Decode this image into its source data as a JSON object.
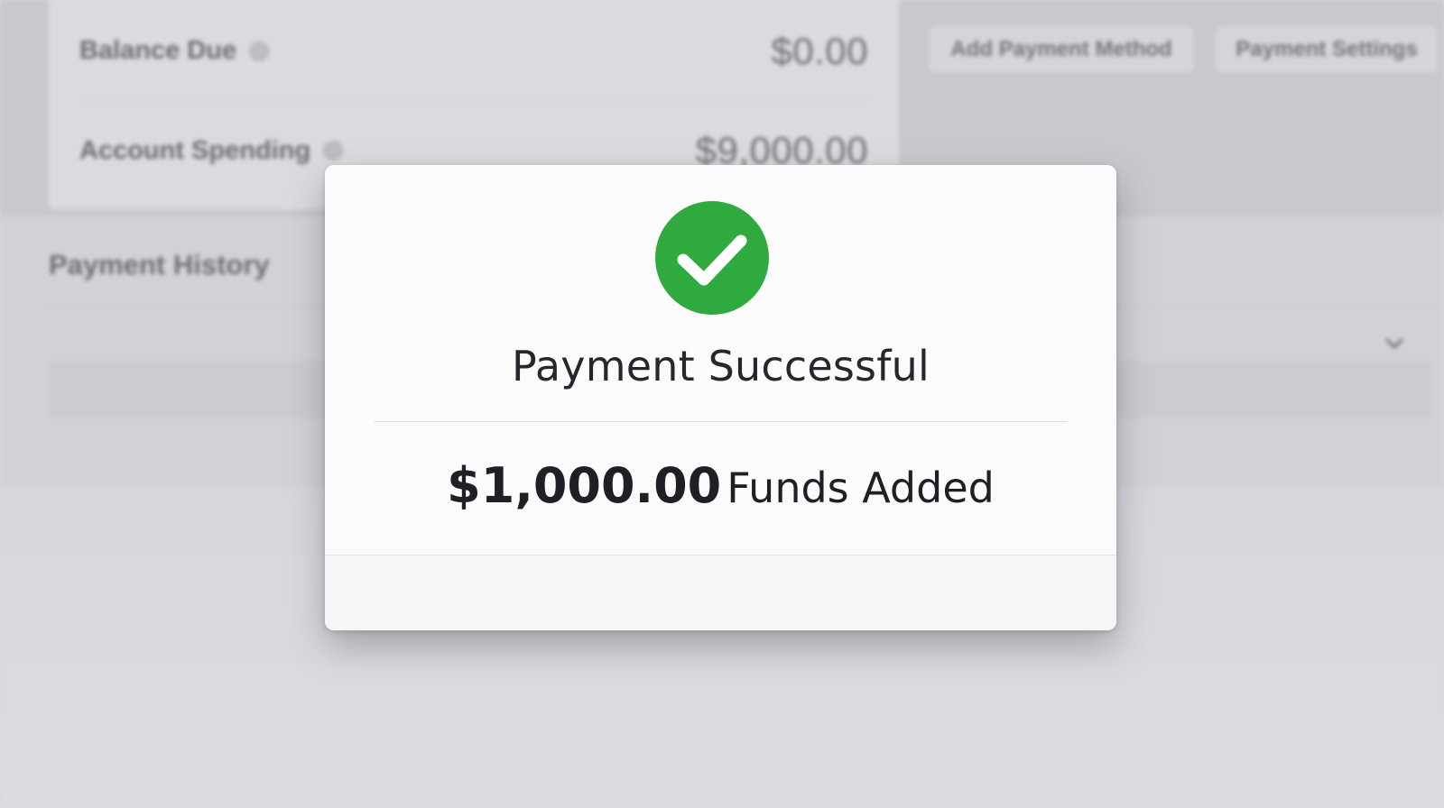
{
  "background": {
    "summary": {
      "balance_due": {
        "label": "Balance Due",
        "value": "$0.00"
      },
      "account_spending": {
        "label": "Account Spending",
        "value": "$9,000.00"
      }
    },
    "buttons": {
      "add_payment_method": "Add Payment Method",
      "payment_settings": "Payment Settings"
    },
    "payment_history": {
      "title": "Payment History"
    }
  },
  "modal": {
    "icon": "check-circle-icon",
    "title": "Payment Successful",
    "amount": "$1,000.00",
    "amount_suffix": "Funds Added"
  },
  "colors": {
    "success_green": "#2eaa3f",
    "modal_background": "#fbfbfc",
    "text_dark": "#26272c"
  }
}
